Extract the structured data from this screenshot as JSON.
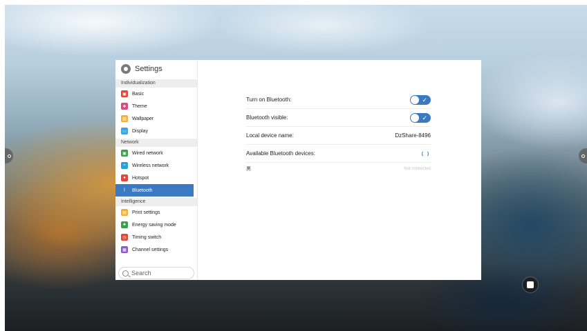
{
  "settings": {
    "title": "Settings",
    "search_placeholder": "Search",
    "sections": [
      {
        "label": "Individualization",
        "items": [
          {
            "label": "Basic",
            "icon": "basic-icon",
            "color": "#e0473a",
            "glyph": "▣"
          },
          {
            "label": "Theme",
            "icon": "theme-icon",
            "color": "#d94a82",
            "glyph": "❖"
          },
          {
            "label": "Wallpaper",
            "icon": "wallpaper-icon",
            "color": "#f2b132",
            "glyph": "▧"
          },
          {
            "label": "Display",
            "icon": "display-icon",
            "color": "#3fa3dd",
            "glyph": "▭"
          }
        ]
      },
      {
        "label": "Network",
        "items": [
          {
            "label": "Wired network",
            "icon": "wired-network-icon",
            "color": "#3aa14a",
            "glyph": "▣"
          },
          {
            "label": "Wireless network",
            "icon": "wireless-network-icon",
            "color": "#2a9fd8",
            "glyph": "≈"
          },
          {
            "label": "Hotspot",
            "icon": "hotspot-icon",
            "color": "#e0473a",
            "glyph": "●"
          },
          {
            "label": "Bluetooth",
            "icon": "bluetooth-icon",
            "color": "#3b79c3",
            "glyph": "ᛒ"
          }
        ]
      },
      {
        "label": "Intelligence",
        "items": [
          {
            "label": "Print settings",
            "icon": "print-settings-icon",
            "color": "#f2b132",
            "glyph": "▤"
          },
          {
            "label": "Energy saving mode",
            "icon": "energy-saving-icon",
            "color": "#3aa14a",
            "glyph": "♣"
          },
          {
            "label": "Timing switch",
            "icon": "timing-switch-icon",
            "color": "#e0473a",
            "glyph": "◷"
          },
          {
            "label": "Channel settings",
            "icon": "channel-settings-icon",
            "color": "#8c5bc7",
            "glyph": "▦"
          }
        ]
      }
    ],
    "active_item": "Bluetooth"
  },
  "bluetooth": {
    "turn_on_label": "Turn on Bluetooth:",
    "turn_on_state": true,
    "visible_label": "Bluetooth visible:",
    "visible_state": true,
    "device_name_label": "Local device name:",
    "device_name_value": "DzShare-8496",
    "available_label": "Available Bluetooth devices:",
    "devices": [
      {
        "name": "黑",
        "status": "Not connected"
      }
    ]
  },
  "colors": {
    "accent": "#3b79c3"
  }
}
